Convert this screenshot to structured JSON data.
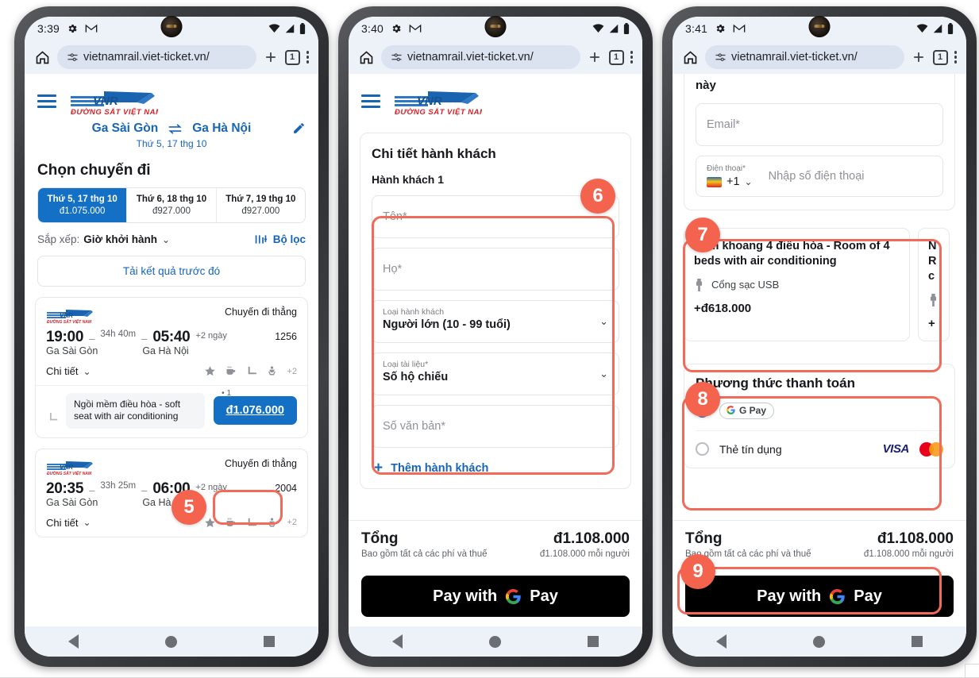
{
  "phones": [
    {
      "id": "phone-1",
      "status": {
        "time": "3:39",
        "icons": [
          "gear-icon",
          "gmail-icon",
          "wifi-icon",
          "signal-icon",
          "battery-icon"
        ]
      },
      "browser": {
        "url": "vietnamrail.viet-ticket.vn/",
        "lock_icon": "tune-icon",
        "new_tab": "+",
        "tab_count": "1",
        "menu": "kebab-menu-icon"
      },
      "site": {
        "logo_text": "VNR",
        "logo_sub": "ĐƯỜNG SẮT VIỆT NAM",
        "route": {
          "from": "Ga Sài Gòn",
          "to": "Ga Hà Nội",
          "swap_icon": "swap-icon",
          "date": "Thứ 5, 17 thg 10",
          "edit_icon": "pencil-icon"
        },
        "heading": "Chọn chuyến đi",
        "date_tabs": [
          {
            "label": "Thứ 5, 17 thg 10",
            "price": "đ1.075.000",
            "active": true
          },
          {
            "label": "Thứ 6, 18 thg 10",
            "price": "đ927.000",
            "active": false
          },
          {
            "label": "Thứ 7, 19 thg 10",
            "price": "đ927.000",
            "active": false
          }
        ],
        "sort": {
          "label": "Sắp xếp:",
          "value": "Giờ khởi hành",
          "filter_label": "Bộ lọc",
          "filter_icon": "sliders-icon"
        },
        "load_previous": "Tải kết quả trước đó",
        "trains": [
          {
            "direct": "Chuyến đi thẳng",
            "depart_time": "19:00",
            "duration": "34h 40m",
            "arrive_time": "05:40",
            "plus_days": "+2 ngày",
            "train_no": "1256",
            "from": "Ga Sài Gòn",
            "to": "Ga Hà Nội",
            "detail_label": "Chi tiết",
            "amenities_more": "+2",
            "seat_name": "Ngồi mềm điều hòa - soft seat with air conditioning",
            "seat_qty": "1",
            "price": "đ1.076.000"
          },
          {
            "direct": "Chuyến đi thẳng",
            "depart_time": "20:35",
            "duration": "33h 25m",
            "arrive_time": "06:00",
            "plus_days": "+2 ngày",
            "train_no": "2004",
            "from": "Ga Sài Gòn",
            "to": "Ga Hà Nội",
            "detail_label": "Chi tiết",
            "amenities_more": "+2"
          }
        ]
      }
    },
    {
      "id": "phone-2",
      "status": {
        "time": "3:40"
      },
      "browser": {
        "url": "vietnamrail.viet-ticket.vn/",
        "tab_count": "1"
      },
      "site": {
        "logo_text": "VNR",
        "logo_sub": "ĐƯỜNG SẮT VIỆT NAM",
        "pax_title": "Chi tiết hành khách",
        "pax_sub": "Hành khách 1",
        "fields": [
          {
            "type": "input",
            "placeholder": "Tên*"
          },
          {
            "type": "input",
            "placeholder": "Họ*"
          },
          {
            "type": "select",
            "label": "Loại hành khách",
            "value": "Người lớn (10 - 99 tuổi)"
          },
          {
            "type": "select",
            "label": "Loại tài liệu*",
            "value": "Số hộ chiếu"
          },
          {
            "type": "input",
            "placeholder": "Số văn bản*"
          }
        ],
        "add_passenger": "Thêm hành khách",
        "total": {
          "label": "Tổng",
          "amount": "đ1.108.000",
          "note": "Bao gồm tất cả các phí và thuế",
          "per_person": "đ1.108.000 mỗi người"
        },
        "pay_button": "Pay with G Pay",
        "pay_button_parts": {
          "pre": "Pay with",
          "post": "Pay"
        }
      }
    },
    {
      "id": "phone-3",
      "status": {
        "time": "3:41"
      },
      "browser": {
        "url": "vietnamrail.viet-ticket.vn/",
        "tab_count": "1"
      },
      "site": {
        "fragment_text": "này",
        "email_placeholder": "Email*",
        "phone": {
          "label": "Điện thoại*",
          "country_code": "+1",
          "placeholder": "Nhập số điện thoại"
        },
        "rooms": [
          {
            "name": "Nằm khoang 4 điều hòa - Room of 4 beds with air conditioning",
            "amenity": "Cổng sạc USB",
            "amenity_icon": "usb-icon",
            "price": "+đ618.000"
          },
          {
            "name": "N R c",
            "amenity": "",
            "price": "+"
          }
        ],
        "payment": {
          "title": "Phương thức thanh toán",
          "options": [
            {
              "label": "G Pay",
              "selected": true,
              "type": "gpay"
            },
            {
              "label": "Thẻ tín dụng",
              "selected": false,
              "type": "card",
              "logos": [
                "VISA",
                "mastercard"
              ]
            }
          ]
        },
        "total": {
          "label": "Tổng",
          "amount": "đ1.108.000",
          "note": "Bao gồm tất cả các phí và thuế",
          "per_person": "đ1.108.000 mỗi người"
        },
        "pay_button_parts": {
          "pre": "Pay with",
          "post": "Pay"
        }
      }
    }
  ],
  "annotations": [
    {
      "num": "5",
      "phone": 1
    },
    {
      "num": "6",
      "phone": 2
    },
    {
      "num": "7",
      "phone": 3
    },
    {
      "num": "8",
      "phone": 3
    },
    {
      "num": "9",
      "phone": 3
    }
  ],
  "colors": {
    "brand_blue": "#1370c4",
    "logo_red": "#d3222a",
    "annotation_red": "#f4634d",
    "black": "#000000"
  }
}
